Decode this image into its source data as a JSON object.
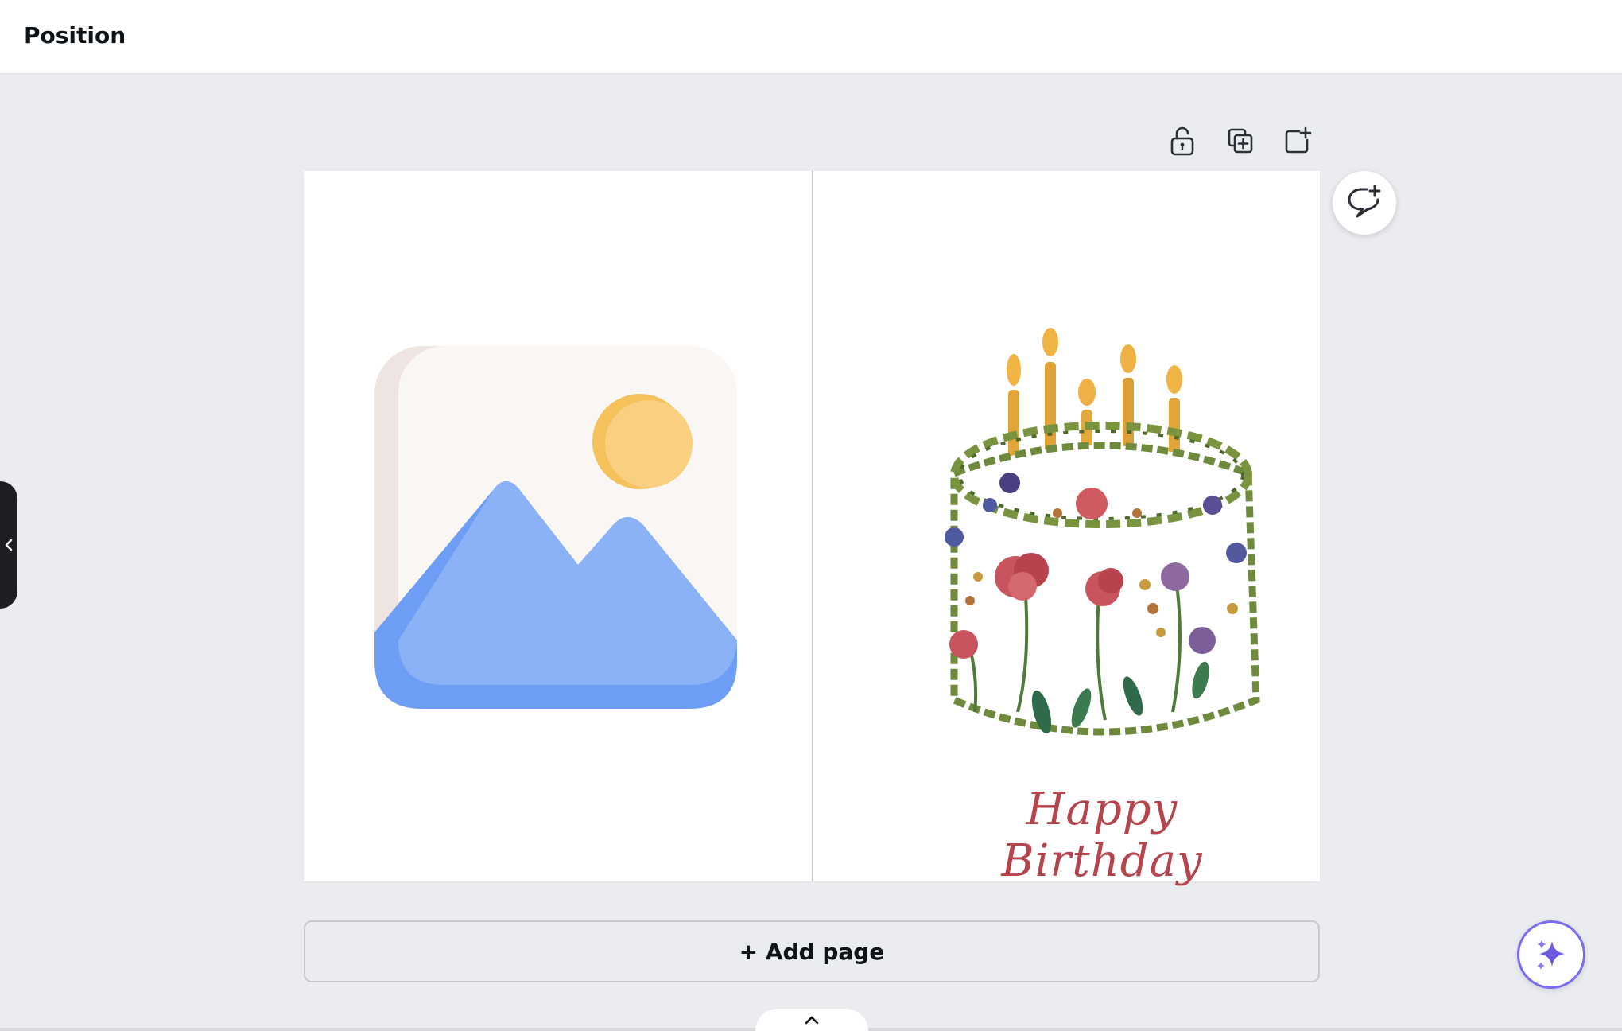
{
  "header": {
    "title": "Position"
  },
  "toolbar": {
    "lock_icon": "unlock-icon",
    "duplicate_icon": "duplicate-page-icon",
    "add_icon": "add-page-icon"
  },
  "canvas": {
    "greeting_text": "Happy Birthday",
    "left_image": "image-placeholder-icon",
    "right_image": "watercolor-birthday-cake"
  },
  "actions": {
    "add_page_label": "+ Add page",
    "comment_icon": "add-comment-icon",
    "ai_icon": "sparkle-icon",
    "collapse_icon": "chevron-left-icon",
    "expand_icon": "chevron-up-icon"
  },
  "colors": {
    "accent": "#7a6cf0",
    "greeting": "#b5444d",
    "background": "#ebecf0"
  }
}
